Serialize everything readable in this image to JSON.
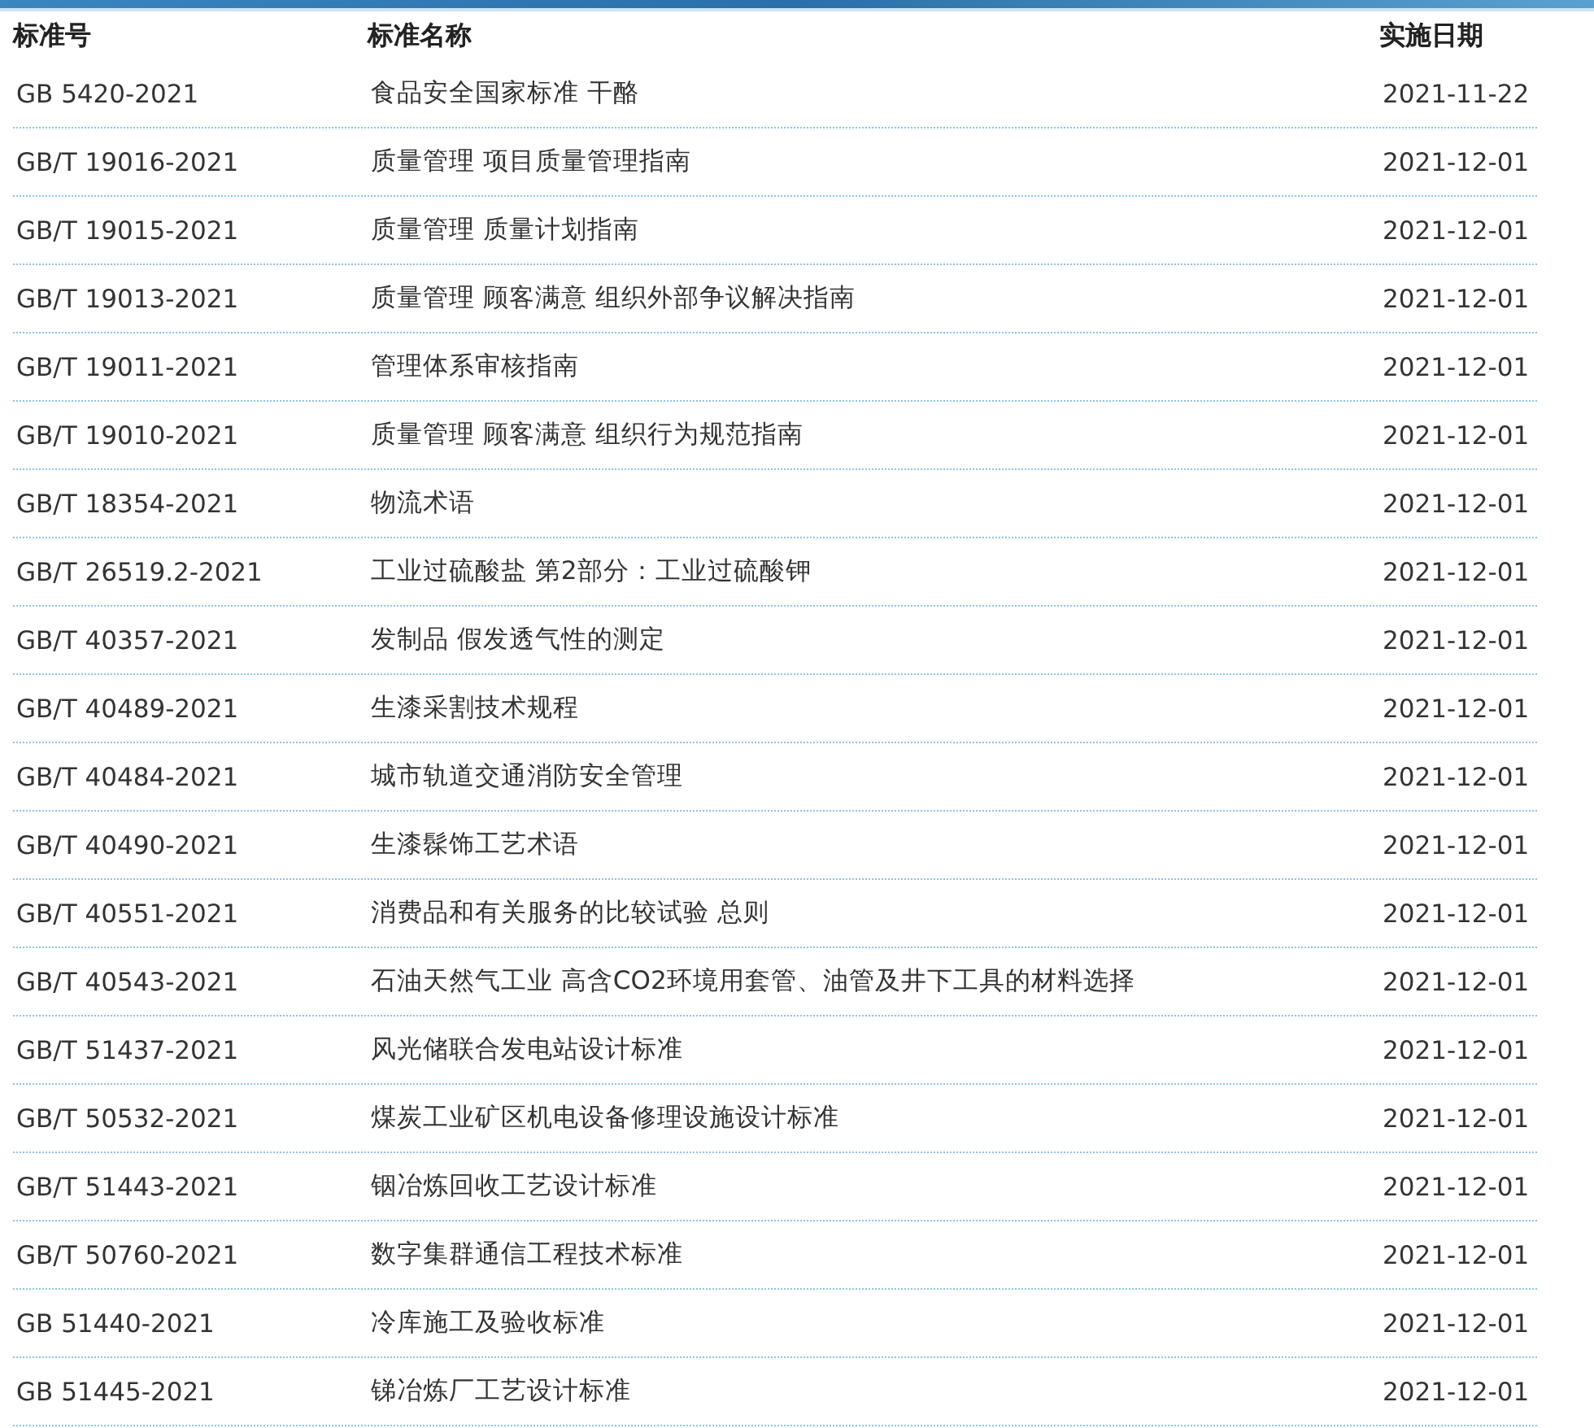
{
  "table": {
    "columns": [
      "标准号",
      "标准名称",
      "实施日期"
    ],
    "rows": [
      [
        "GB 5420-2021",
        "食品安全国家标准 干酪",
        "2021-11-22"
      ],
      [
        "GB/T 19016-2021",
        "质量管理 项目质量管理指南",
        "2021-12-01"
      ],
      [
        "GB/T 19015-2021",
        "质量管理 质量计划指南",
        "2021-12-01"
      ],
      [
        "GB/T 19013-2021",
        "质量管理 顾客满意 组织外部争议解决指南",
        "2021-12-01"
      ],
      [
        "GB/T 19011-2021",
        "管理体系审核指南",
        "2021-12-01"
      ],
      [
        "GB/T 19010-2021",
        "质量管理 顾客满意 组织行为规范指南",
        "2021-12-01"
      ],
      [
        "GB/T 18354-2021",
        "物流术语",
        "2021-12-01"
      ],
      [
        "GB/T 26519.2-2021",
        "工业过硫酸盐 第2部分：工业过硫酸钾",
        "2021-12-01"
      ],
      [
        "GB/T 40357-2021",
        "发制品 假发透气性的测定",
        "2021-12-01"
      ],
      [
        "GB/T 40489-2021",
        "生漆采割技术规程",
        "2021-12-01"
      ],
      [
        "GB/T 40484-2021",
        "城市轨道交通消防安全管理",
        "2021-12-01"
      ],
      [
        "GB/T 40490-2021",
        "生漆髹饰工艺术语",
        "2021-12-01"
      ],
      [
        "GB/T 40551-2021",
        "消费品和有关服务的比较试验 总则",
        "2021-12-01"
      ],
      [
        "GB/T 40543-2021",
        "石油天然气工业 高含CO2环境用套管、油管及井下工具的材料选择",
        "2021-12-01"
      ],
      [
        "GB/T 51437-2021",
        "风光储联合发电站设计标准",
        "2021-12-01"
      ],
      [
        "GB/T 50532-2021",
        "煤炭工业矿区机电设备修理设施设计标准",
        "2021-12-01"
      ],
      [
        "GB/T 51443-2021",
        "铟冶炼回收工艺设计标准",
        "2021-12-01"
      ],
      [
        "GB/T 50760-2021",
        "数字集群通信工程技术标准",
        "2021-12-01"
      ],
      [
        "GB 51440-2021",
        "冷库施工及验收标准",
        "2021-12-01"
      ],
      [
        "GB 51445-2021",
        "锑冶炼厂工艺设计标准",
        "2021-12-01"
      ]
    ]
  }
}
